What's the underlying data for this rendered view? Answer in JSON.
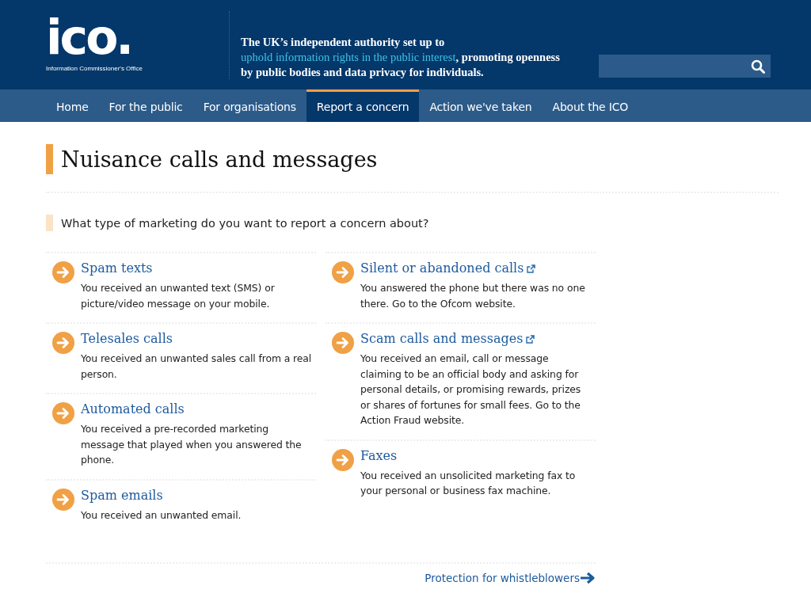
{
  "logo": {
    "mark": "ico.",
    "subtitle": "Information Commissioner's Office"
  },
  "tagline": {
    "before": "The UK’s independent authority set up to ",
    "link": "uphold information rights in the public interest",
    "after": ", promoting openness by public bodies and data privacy for individuals."
  },
  "nav": [
    {
      "label": "Home",
      "selected": false
    },
    {
      "label": "For the public",
      "selected": false
    },
    {
      "label": "For organisations",
      "selected": false
    },
    {
      "label": "Report a concern",
      "selected": true
    },
    {
      "label": "Action we've taken",
      "selected": false
    },
    {
      "label": "About the ICO",
      "selected": false
    }
  ],
  "heading": "Nuisance calls and messages",
  "question": "What type of marketing do you want to report a concern about?",
  "columns": [
    {
      "items": [
        {
          "title": "Spam texts",
          "external": false,
          "description": "You received an unwanted text (SMS) or picture/video message on your mobile."
        },
        {
          "title": "Telesales calls",
          "external": false,
          "description": "You received an unwanted sales call from a real person."
        },
        {
          "title": "Automated calls",
          "external": false,
          "description": "You received a pre-recorded marketing message that played when you answered the phone."
        },
        {
          "title": "Spam emails",
          "external": false,
          "description": "You received an unwanted email."
        }
      ]
    },
    {
      "items": [
        {
          "title": "Silent or abandoned calls",
          "external": true,
          "description": "You answered the phone but there was no one there. Go to the Ofcom website."
        },
        {
          "title": "Scam calls and messages",
          "external": true,
          "description": "You received an email, call or message claiming to be an official body and asking for personal details, or promising rewards, prizes or shares of fortunes for small fees. Go to the Action Fraud website."
        },
        {
          "title": "Faxes",
          "external": false,
          "description": "You received an unsolicited marketing fax to your personal or business fax machine."
        }
      ]
    }
  ],
  "footer_link": "Protection for whistleblowers"
}
